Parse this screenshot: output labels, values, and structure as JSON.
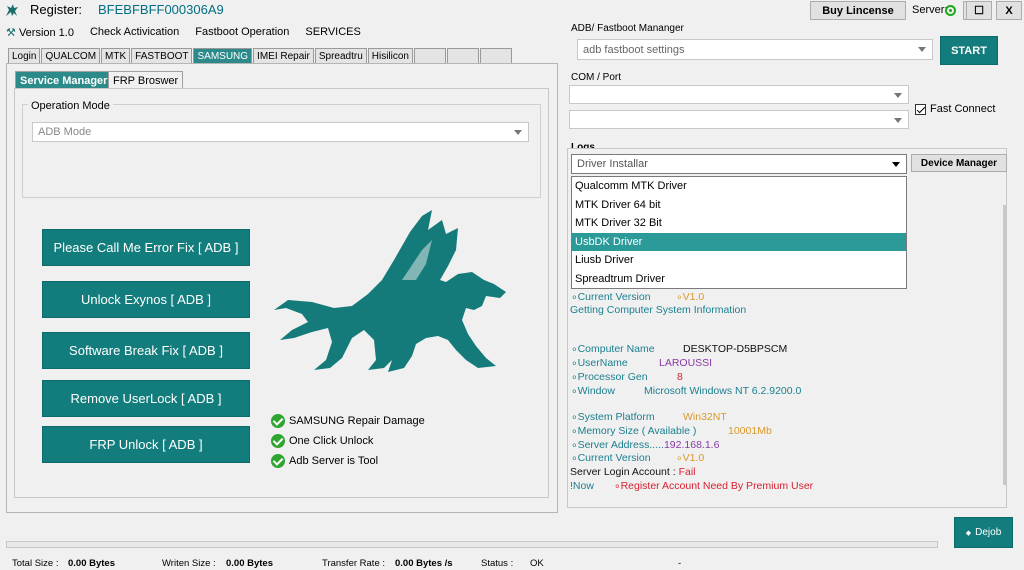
{
  "titlebar": {
    "register_label": "Register:",
    "register_value": "BFEBFBFF000306A9",
    "buy_button": "Buy Lincense",
    "server_label": "Server:",
    "window_buttons": [
      "_",
      "☐",
      "X"
    ]
  },
  "menu": [
    "Version 1.0",
    "Check Activication",
    "Fastboot Operation",
    "SERVICES"
  ],
  "top_tabs": [
    "Login",
    "QUALCOM",
    "MTK",
    "FASTBOOT",
    "SAMSUNG",
    "IMEI Repair",
    "Spreadtru",
    "Hisilicon"
  ],
  "active_top_tab": "SAMSUNG",
  "sub_tabs": [
    "Service Manager",
    "FRP Broswer"
  ],
  "operation_mode": {
    "title": "Operation Mode",
    "value": "ADB Mode"
  },
  "action_buttons": [
    "Please Call Me Error Fix [ ADB ]",
    "Unlock Exynos [ ADB ]",
    "Software Break Fix [ ADB ]",
    "Remove UserLock [ ADB ]",
    "FRP Unlock [ ADB ]"
  ],
  "features": [
    "SAMSUNG Repair Damage",
    "One Click Unlock",
    "Adb Server is Tool"
  ],
  "adb": {
    "title": "ADB/ Fastboot Mananger",
    "value": "adb fastboot settings",
    "start": "START"
  },
  "com": {
    "title": "COM / Port",
    "fast_connect": "Fast Connect"
  },
  "logs": {
    "title": "Logs",
    "driver_select": "Driver Installar",
    "device_manager": "Device Manager",
    "driver_options": [
      "Qualcomm MTK Driver",
      "MTK Driver 64 bit",
      "MTK Driver 32 Bit",
      "UsbDK Driver",
      "Liusb Driver",
      "Spreadtrum Driver"
    ],
    "selected_option": "UsbDK Driver",
    "lines": {
      "cv1_label": "Current Version",
      "cv1_value": "V1.0",
      "getting": "Getting Computer System Information",
      "pc_label": "Computer Name",
      "pc_value": "DESKTOP-D5BPSCM",
      "user_label": "UserName",
      "user_value": "LAROUSSI",
      "proc_label": "Processor Gen",
      "proc_value": "8",
      "win_label": "Window",
      "win_value": "Microsoft Windows NT 6.2.9200.0",
      "plat_label": "System Platform",
      "plat_value": "Win32NT",
      "mem_label": "Memory Size ( Available )",
      "mem_value": "10001Mb",
      "addr_label": "Server Address.....",
      "addr_value": "192.168.1.6",
      "cv2_label": "Current Version",
      "cv2_value": "V1.0",
      "login_label": "Server Login Account :",
      "login_value": "Fail",
      "now_label": "!Now",
      "now_value": "Register Account Need By Premium User"
    }
  },
  "dejob_button": "Dejob",
  "statusbar": {
    "total_label": "Total Size :",
    "total_value": "0.00 Bytes",
    "written_label": "Writen Size :",
    "written_value": "0.00 Bytes",
    "rate_label": "Transfer Rate :",
    "rate_value": "0.00 Bytes /s",
    "status_label": "Status :",
    "status_value": "OK",
    "dash": "-"
  },
  "colors": {
    "accent": "#137d7d",
    "tab_active": "#2d8a8a",
    "selected": "#2d9a9a"
  }
}
